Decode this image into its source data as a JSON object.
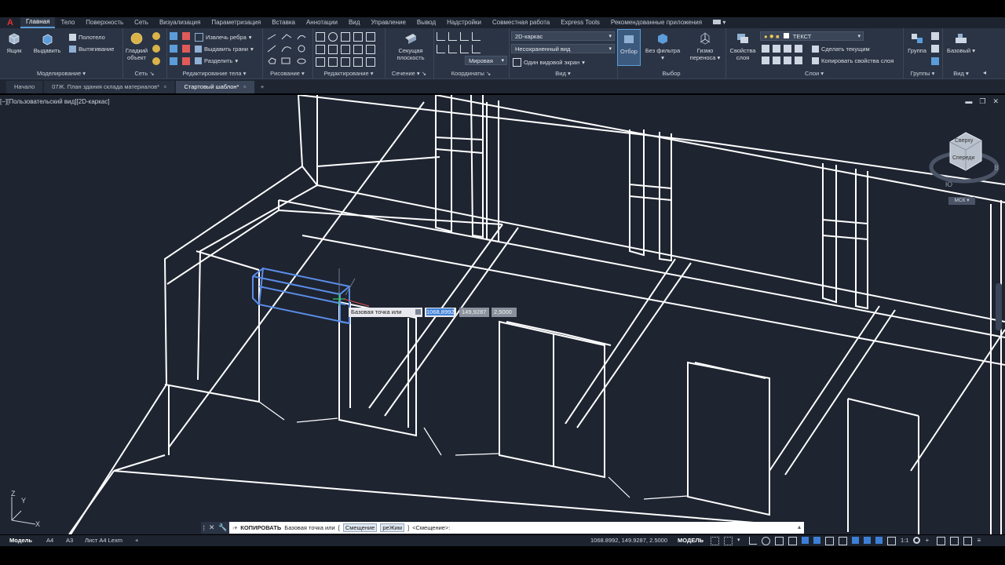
{
  "app": {
    "logo": "A"
  },
  "ribbon_tabs": [
    "Главная",
    "Тело",
    "Поверхность",
    "Сеть",
    "Визуализация",
    "Параметризация",
    "Вставка",
    "Аннотации",
    "Вид",
    "Управление",
    "Вывод",
    "Надстройки",
    "Совместная работа",
    "Express Tools",
    "Рекомендованные приложения"
  ],
  "panels": {
    "modeling": {
      "title": "Моделирование",
      "box": "Ящик",
      "extrude": "Выдавить",
      "polysolid": "Полотело",
      "presspull": "Вытягивание"
    },
    "mesh": {
      "title": "Сеть",
      "smooth": "Гладкий объект"
    },
    "solid_edit": {
      "title": "Редактирование тела",
      "extract_edges": "Извлечь ребра",
      "extrude_faces": "Выдавить грани",
      "separate": "Разделить"
    },
    "draw": {
      "title": "Рисование"
    },
    "modify": {
      "title": "Редактирование"
    },
    "section": {
      "title": "Сечение",
      "plane": "Секущая плоскость"
    },
    "coordinates": {
      "title": "Координаты",
      "ucs": "Мировая"
    },
    "view": {
      "title": "Вид",
      "visual_style": "2D-каркас",
      "named_view": "Несохраненный вид",
      "viewport_config": "Один видовой экран"
    },
    "selection": {
      "title": "Выбор",
      "culling": "Отбор",
      "no_filter": "Без фильтра",
      "gizmo": "Гизмо переноса"
    },
    "layers": {
      "title": "Слои",
      "properties": "Свойства слоя",
      "current_layer": "ТЕКСТ",
      "make_current": "Сделать текущим",
      "match_layer": "Копировать свойства слоя"
    },
    "groups": {
      "title": "Группы",
      "group": "Группа"
    },
    "view2": {
      "title": "Вид",
      "base": "Базовый"
    }
  },
  "doc_tabs": [
    {
      "label": "Начало",
      "active": false,
      "closable": false
    },
    {
      "label": "07Ж. План здания склада материалов*",
      "active": false,
      "closable": true
    },
    {
      "label": "Стартовый шаблон*",
      "active": true,
      "closable": true
    }
  ],
  "viewport": {
    "label": "[−][Пользовательский вид][2D-каркас]",
    "viewcube_top": "Сверху",
    "viewcube_front": "Спереди",
    "compass_s": "Ю",
    "compass_e": "В",
    "ucs_label": "МСК",
    "axis_x": "X",
    "axis_y": "Y",
    "axis_z": "Z"
  },
  "dynamic_input": {
    "prompt": "Базовая точка или",
    "x": "1068,8992",
    "y": "149,9287",
    "z": "2,5000"
  },
  "command_line": {
    "command": "КОПИРОВАТЬ",
    "prompt": "Базовая точка или",
    "option1": "Смещение",
    "option2": "реЖим",
    "default": "<Смещение>:"
  },
  "status": {
    "layouts": [
      "Модель",
      "А4",
      "А3",
      "Лист А4 Lexm"
    ],
    "coords": "1068.8992, 149.9287, 2.5000",
    "mode": "МОДЕЛЬ",
    "scale": "1:1"
  }
}
